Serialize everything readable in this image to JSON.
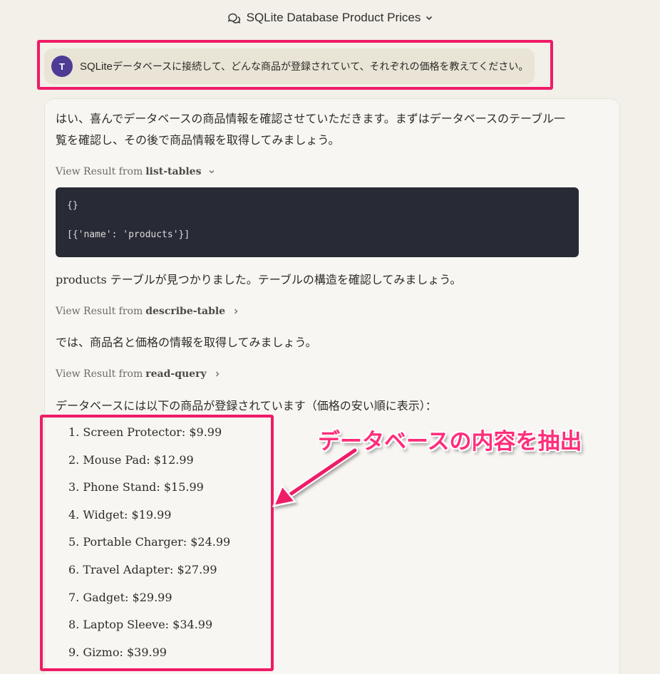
{
  "header": {
    "title": "SQLite Database Product Prices"
  },
  "user": {
    "avatar_initial": "T",
    "message_prefix": "SQLite",
    "message_rest": "データベースに接続して、どんな商品が登録されていて、それぞれの価格を教えてください。"
  },
  "assistant": {
    "intro": "はい、喜んでデータベースの商品情報を確認させていただきます。まずはデータベースのテーブル一覧を確認し、その後で商品情報を取得してみましょう。",
    "tool1": {
      "prefix": "View Result from",
      "name": "list-tables"
    },
    "code_lines": [
      "{}",
      "[{'name': 'products'}]"
    ],
    "para2": "products テーブルが見つかりました。テーブルの構造を確認してみましょう。",
    "tool2": {
      "prefix": "View Result from",
      "name": "describe-table"
    },
    "para3": "では、商品名と価格の情報を取得してみましょう。",
    "tool3": {
      "prefix": "View Result from",
      "name": "read-query"
    },
    "para4": "データベースには以下の商品が登録されています（価格の安い順に表示）：",
    "products": [
      "1. Screen Protector: $9.99",
      "2. Mouse Pad: $12.99",
      "3. Phone Stand: $15.99",
      "4. Widget: $19.99",
      "5. Portable Charger: $24.99",
      "6. Travel Adapter: $27.99",
      "7. Gadget: $29.99",
      "8. Laptop Sleeve: $34.99",
      "9. Gizmo: $39.99"
    ]
  },
  "annotation": {
    "callout": "データベースの内容を抽出",
    "color": "#ef1b68"
  }
}
